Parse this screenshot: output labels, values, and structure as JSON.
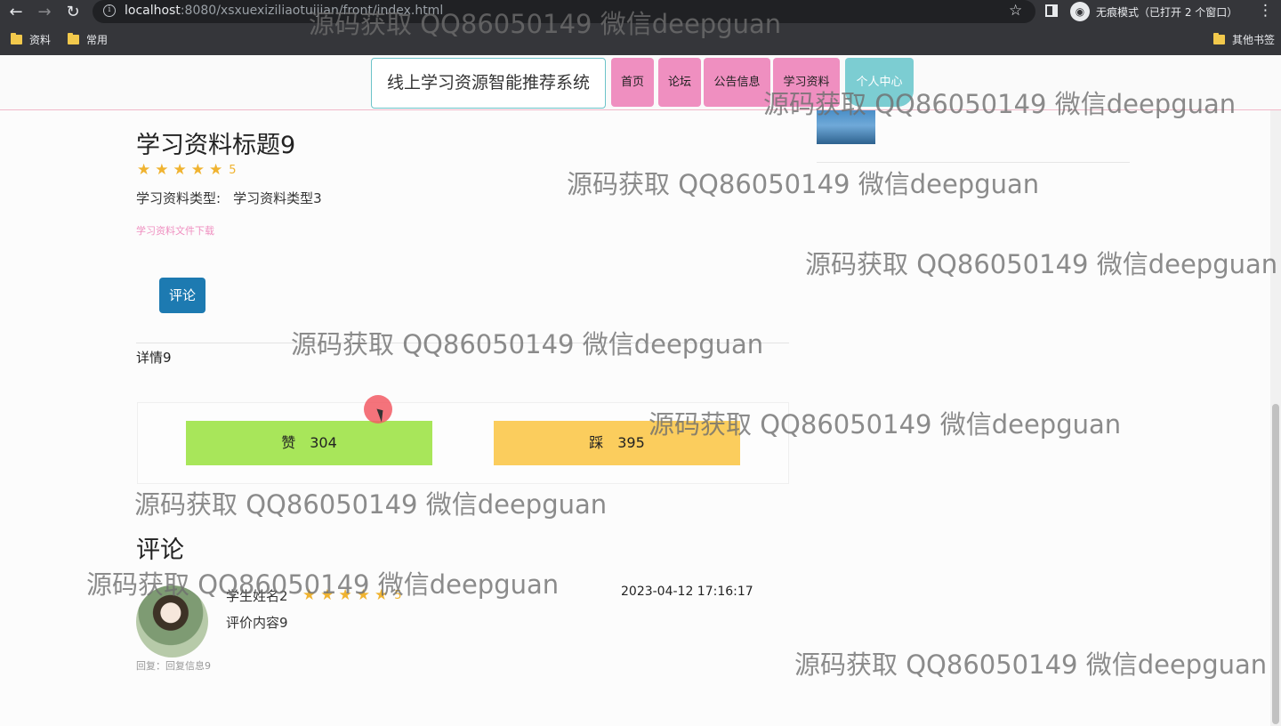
{
  "browser": {
    "url_host": "localhost",
    "url_rest": ":8080/xsxuexiziliaotuijian/front/index.html",
    "incognito_label": "无痕模式（已打开 2 个窗口）",
    "bookmarks": [
      "资料",
      "常用",
      "其他书签"
    ]
  },
  "header": {
    "logo": "线上学习资源智能推荐系统",
    "nav": [
      "首页",
      "论坛",
      "公告信息",
      "学习资料",
      "个人中心"
    ]
  },
  "material": {
    "title": "学习资料标题9",
    "rating": 5,
    "rating_text": "5",
    "type_label": "学习资料类型:",
    "type_value": "学习资料类型3",
    "download_link": "学习资料文件下载",
    "comment_button": "评论",
    "detail": "详情9"
  },
  "votes": {
    "up_label": "赞",
    "up_count": "304",
    "down_label": "踩",
    "down_count": "395"
  },
  "comments": {
    "section_title": "评论",
    "items": [
      {
        "author": "学生姓名2",
        "rating": 5,
        "rating_text": "5",
        "date": "2023-04-12 17:16:17",
        "content": "评价内容9",
        "reply": "回复：回复信息9"
      }
    ]
  },
  "watermark": "源码获取 QQ86050149 微信deepguan",
  "colors": {
    "nav_pink": "#ef8fc0",
    "nav_active": "#7ccdd2",
    "comment_button": "#1d7ab1",
    "vote_up": "#a8e65a",
    "vote_down": "#fbcd5d",
    "star": "#f0b330"
  }
}
